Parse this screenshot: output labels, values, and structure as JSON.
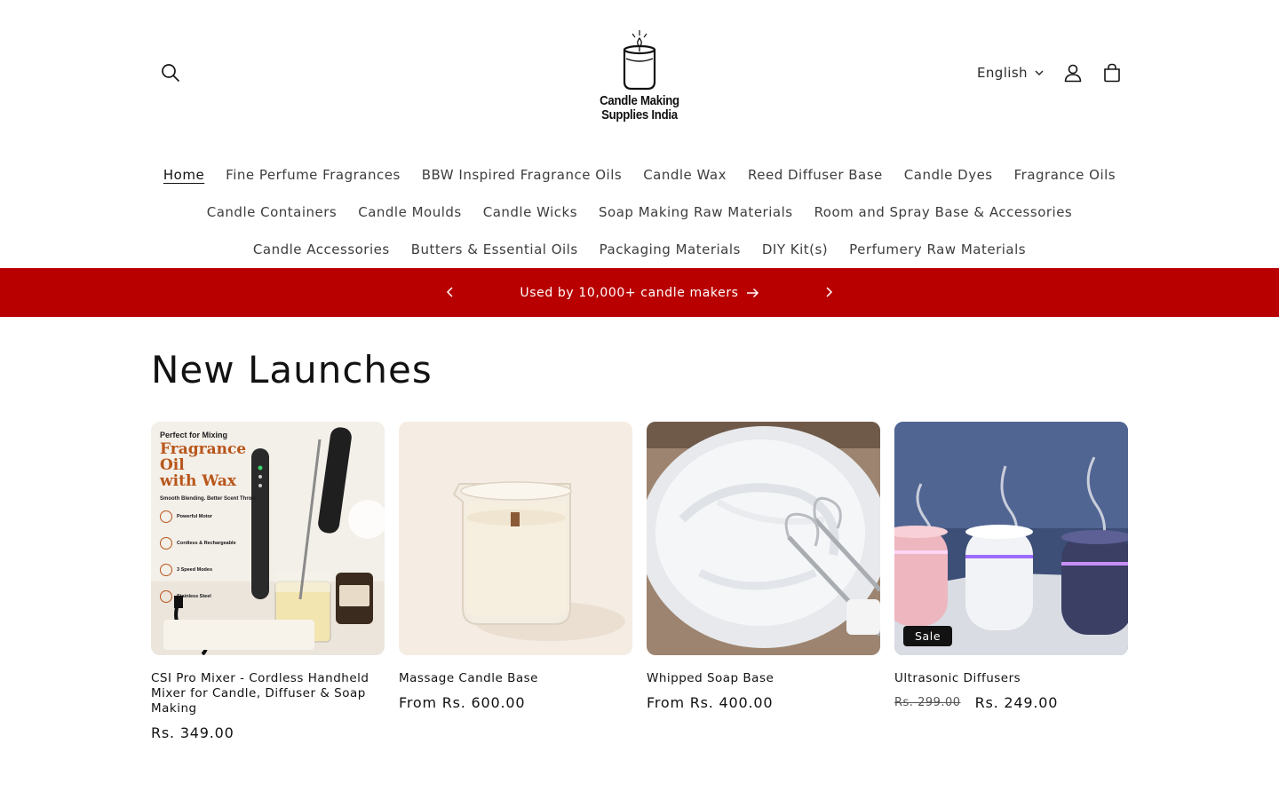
{
  "header": {
    "language": "English",
    "logo": {
      "line1": "Candle Making",
      "line2": "Supplies India"
    },
    "icons": {
      "search": "search-icon",
      "account": "account-icon",
      "cart": "cart-icon",
      "language_chevron": "chevron-down-icon"
    }
  },
  "nav": {
    "row1": [
      "Home",
      "Fine Perfume Fragrances",
      "BBW Inspired Fragrance Oils",
      "Candle Wax",
      "Reed Diffuser Base",
      "Candle Dyes",
      "Fragrance Oils"
    ],
    "row2": [
      "Candle Containers",
      "Candle Moulds",
      "Candle Wicks",
      "Soap Making Raw Materials",
      "Room and Spray Base & Accessories"
    ],
    "row3": [
      "Candle Accessories",
      "Butters & Essential Oils",
      "Packaging Materials",
      "DIY Kit(s)",
      "Perfumery Raw Materials"
    ]
  },
  "announcement": {
    "text": "Used by 10,000+ candle makers",
    "color": "#b80000"
  },
  "section": {
    "title": "New Launches"
  },
  "products": [
    {
      "title": "CSI Pro Mixer - Cordless Handheld Mixer for Candle, Diffuser & Soap Making",
      "price": "Rs. 349.00",
      "image_text": {
        "tag": "Perfect for Mixing",
        "headline1": "Fragrance Oil",
        "headline2": "with Wax",
        "sub": "Smooth Blending. Better Scent Throw.",
        "f1": "Powerful Motor",
        "f2": "Cordless & Rechargeable",
        "f3": "3 Speed Modes",
        "f4": "Stainless Steel"
      }
    },
    {
      "title": "Massage Candle Base",
      "price": "From Rs. 600.00"
    },
    {
      "title": "Whipped Soap Base",
      "price": "From Rs. 400.00"
    },
    {
      "title": "Ultrasonic Diffusers",
      "price_old": "Rs. 299.00",
      "price": "Rs. 249.00",
      "badge": "Sale"
    }
  ]
}
